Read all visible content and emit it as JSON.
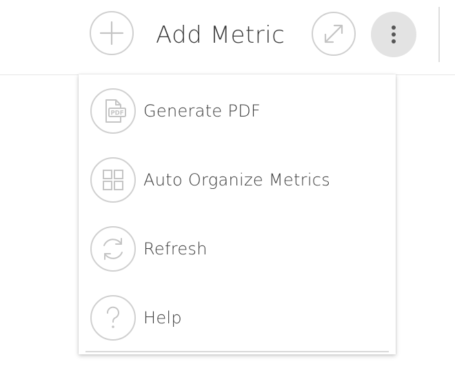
{
  "toolbar": {
    "add_metric_label": "Add Metric",
    "add_icon": "plus-icon",
    "expand_icon": "expand-arrows-icon",
    "more_icon": "vertical-dots-icon"
  },
  "menu": {
    "items": [
      {
        "label": "Generate PDF",
        "icon": "pdf-file-icon"
      },
      {
        "label": "Auto Organize Metrics",
        "icon": "grid-icon"
      },
      {
        "label": "Refresh",
        "icon": "refresh-icon"
      },
      {
        "label": "Help",
        "icon": "question-mark-icon"
      }
    ]
  },
  "colors": {
    "icon_stroke": "#c8c8c8",
    "text": "#3a3a3a",
    "more_button_bg": "#e3e3e3",
    "dots": "#555555"
  }
}
